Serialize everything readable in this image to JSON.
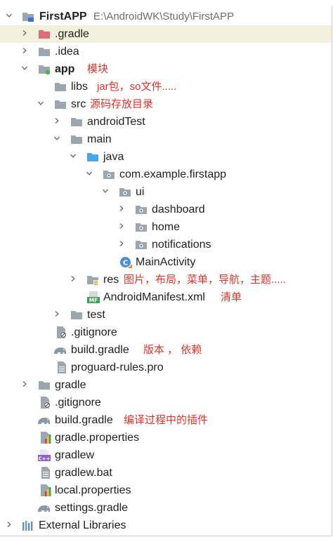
{
  "project": {
    "name": "FirstAPP",
    "path": "E:\\AndroidWK\\Study\\FirstAPP"
  },
  "tree": {
    "gradle_dir_1": ".gradle",
    "idea": ".idea",
    "app": "app",
    "libs": "libs",
    "src": "src",
    "androidTest": "androidTest",
    "main": "main",
    "java": "java",
    "package": "com.example.firstapp",
    "ui": "ui",
    "dashboard": "dashboard",
    "home": "home",
    "notifications": "notifications",
    "main_activity": "MainActivity",
    "res": "res",
    "manifest": "AndroidManifest.xml",
    "test": "test",
    "app_gitignore": ".gitignore",
    "app_build_gradle": "build.gradle",
    "proguard": "proguard-rules.pro",
    "gradle_dir_2": "gradle",
    "root_gitignore": ".gitignore",
    "root_build_gradle": "build.gradle",
    "gradle_properties": "gradle.properties",
    "gradlew": "gradlew",
    "gradlew_bat": "gradlew.bat",
    "local_properties": "local.properties",
    "settings_gradle": "settings.gradle",
    "external_libraries": "External Libraries"
  },
  "annotations": {
    "app": "模块",
    "libs": "jar包，so文件.....",
    "src": "源码存放目录",
    "res": "图片，布局，菜单，导航，主题.....",
    "manifest": "清单",
    "app_build_gradle": "版本 ， 依赖",
    "root_build_gradle": "编译过程中的插件"
  },
  "colors": {
    "selected_row": "#f3f1dd",
    "annotation": "#e0322b",
    "folder": "#9aa7b0",
    "source_folder": "#4aa8e8",
    "excluded_folder": "#e06c75"
  }
}
